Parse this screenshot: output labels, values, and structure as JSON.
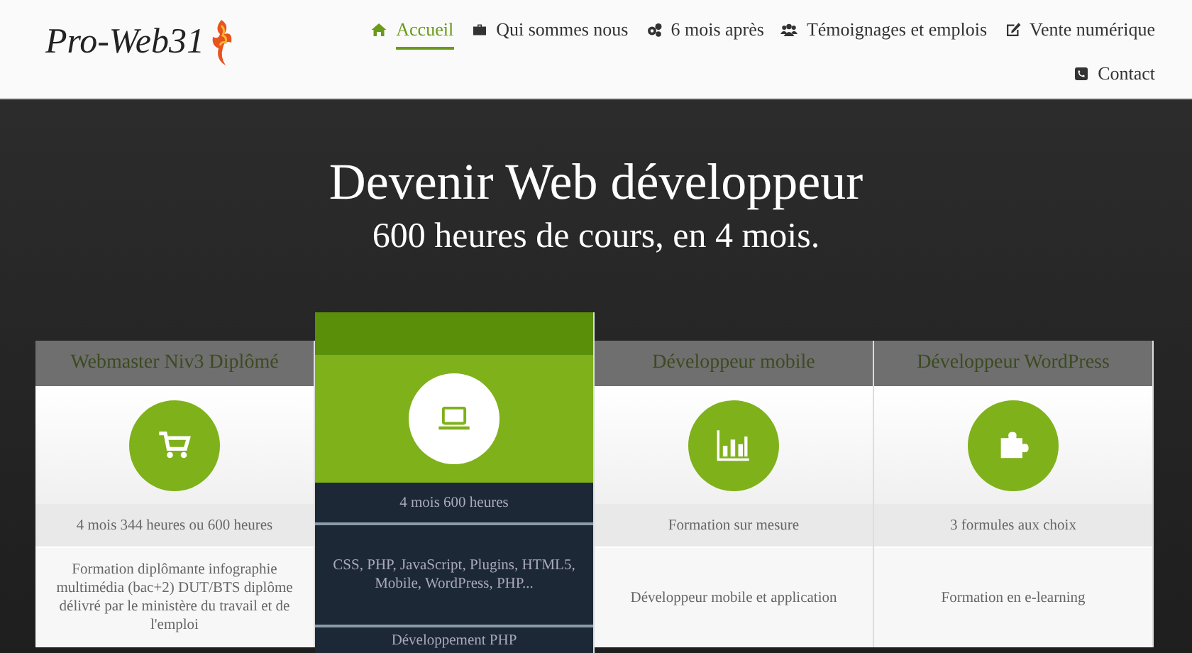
{
  "logo": {
    "text": "Pro-Web31"
  },
  "nav": [
    {
      "label": "Accueil",
      "selected": true
    },
    {
      "label": "Qui sommes nous",
      "selected": false
    },
    {
      "label": "6 mois après",
      "selected": false
    },
    {
      "label": "Témoignages et emplois",
      "selected": false
    },
    {
      "label": "Vente numérique",
      "selected": false
    },
    {
      "label": "Contact",
      "selected": false
    }
  ],
  "hero": {
    "title": "Devenir Web développeur",
    "subtitle": "600 heures de cours, en 4 mois."
  },
  "plans": [
    {
      "title": "Webmaster Niv3 Diplômé",
      "featured": false,
      "rows": [
        "4 mois 344 heures ou 600 heures",
        "Formation diplômante infographie multimédia (bac+2) DUT/BTS diplôme délivré par le ministère du travail et de l'emploi"
      ]
    },
    {
      "featured": true,
      "rows": [
        "4 mois 600 heures",
        "CSS, PHP, JavaScript, Plugins, HTML5, Mobile, WordPress, PHP...",
        "Développement PHP"
      ]
    },
    {
      "title": "Développeur mobile",
      "featured": false,
      "rows": [
        "Formation sur mesure",
        "Développeur mobile et application"
      ]
    },
    {
      "title": "Développeur WordPress",
      "featured": false,
      "rows": [
        "3 formules aux choix",
        "Formation en e-learning"
      ]
    }
  ]
}
